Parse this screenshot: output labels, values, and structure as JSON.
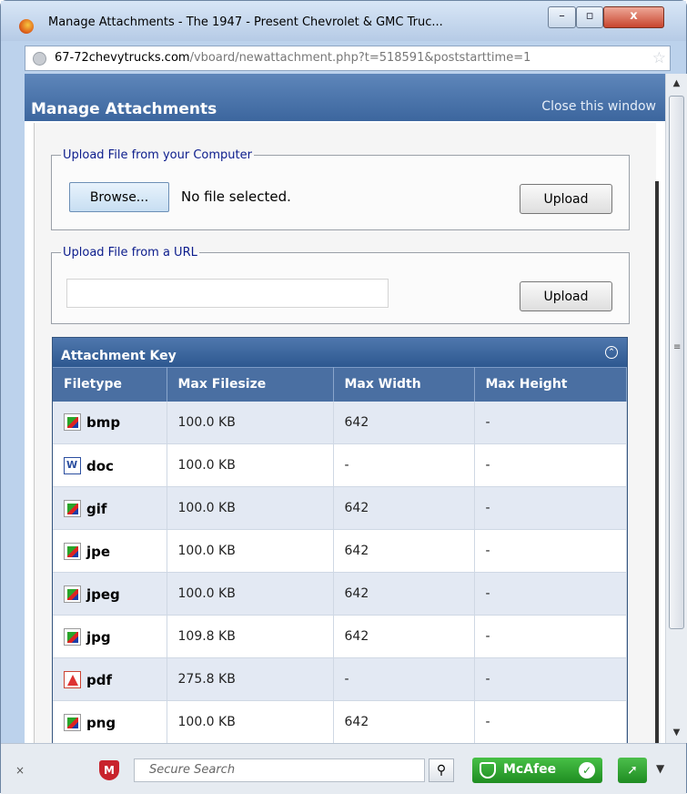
{
  "window": {
    "title": "Manage Attachments - The 1947 - Present Chevrolet & GMC Truc...",
    "buttons": {
      "minimize": "–",
      "maximize": "▫",
      "close": "x"
    }
  },
  "address": {
    "host": "67-72chevytrucks.com",
    "path": "/vboard/newattachment.php?t=518591&poststarttime=1"
  },
  "manage": {
    "heading": "Manage Attachments",
    "close_link": "Close this window"
  },
  "upload_computer": {
    "legend": "Upload File from your Computer",
    "browse_label": "Browse...",
    "status": "No file selected.",
    "upload_label": "Upload"
  },
  "upload_url": {
    "legend": "Upload File from a URL",
    "value": "",
    "upload_label": "Upload"
  },
  "attachment_key": {
    "title": "Attachment Key",
    "toggle_icon": "collapse-icon",
    "columns": [
      "Filetype",
      "Max Filesize",
      "Max Width",
      "Max Height"
    ],
    "rows": [
      {
        "type": "bmp",
        "icon": "image-file-icon",
        "size": "100.0 KB",
        "width": "642",
        "height": "-"
      },
      {
        "type": "doc",
        "icon": "word-file-icon",
        "size": "100.0 KB",
        "width": "-",
        "height": "-"
      },
      {
        "type": "gif",
        "icon": "image-file-icon",
        "size": "100.0 KB",
        "width": "642",
        "height": "-"
      },
      {
        "type": "jpe",
        "icon": "image-file-icon",
        "size": "100.0 KB",
        "width": "642",
        "height": "-"
      },
      {
        "type": "jpeg",
        "icon": "image-file-icon",
        "size": "100.0 KB",
        "width": "642",
        "height": "-"
      },
      {
        "type": "jpg",
        "icon": "image-file-icon",
        "size": "109.8 KB",
        "width": "642",
        "height": "-"
      },
      {
        "type": "pdf",
        "icon": "pdf-file-icon",
        "size": "275.8 KB",
        "width": "-",
        "height": "-"
      },
      {
        "type": "png",
        "icon": "image-file-icon",
        "size": "100.0 KB",
        "width": "642",
        "height": "-"
      }
    ]
  },
  "bottom_bar": {
    "close_glyph": "×",
    "search_placeholder": "Secure Search",
    "mcafee_label": "McAfee"
  }
}
